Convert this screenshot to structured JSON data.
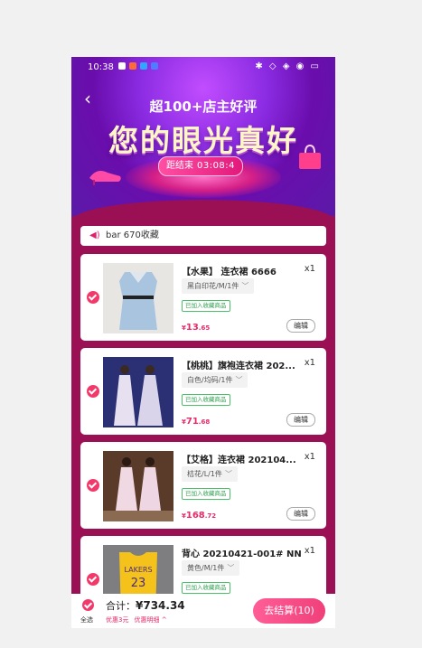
{
  "status_bar": {
    "time": "10:38",
    "right_icons": "✱ ◇ ◈ ◉ ▭"
  },
  "header": {
    "subtitle": "超100+店主好评",
    "title": "您的眼光真好",
    "countdown_label": "距结束",
    "countdown_value": "03:08:4"
  },
  "notice": {
    "text": "bar 670收藏"
  },
  "items": [
    {
      "name": "【水果】 连衣裙 6666",
      "qty": "x1",
      "spec": "黑白印花/M/1件",
      "tag": "已加入收藏商品",
      "price_int": "13",
      "price_dec": ".65",
      "edit": "编辑"
    },
    {
      "name": "【桃桃】旗袍连衣裙 202...",
      "qty": "x1",
      "spec": "白色/均码/1件",
      "tag": "已加入收藏商品",
      "price_int": "71",
      "price_dec": ".68",
      "edit": "编辑"
    },
    {
      "name": "【艾格】连衣裙 202104...",
      "qty": "x1",
      "spec": "桔花/L/1件",
      "tag": "已加入收藏商品",
      "price_int": "168",
      "price_dec": ".72",
      "edit": "编辑"
    },
    {
      "name": "背心 20210421-001# NN",
      "qty": "x1",
      "spec": "黄色/M/1件",
      "tag": "已加入收藏商品",
      "price_int": "",
      "price_dec": "",
      "edit": ""
    }
  ],
  "currency_symbol": "¥",
  "chevron": "﹀",
  "footer": {
    "select_all": "全选",
    "total_label": "合计：",
    "total_amount": "¥734.34",
    "discount": "优惠3元",
    "discount_detail": "优惠明细 ^",
    "checkout": "去结算(10)"
  },
  "colors": {
    "accent": "#f3396a",
    "background": "#9b1055",
    "hero": "#6a0dad"
  }
}
